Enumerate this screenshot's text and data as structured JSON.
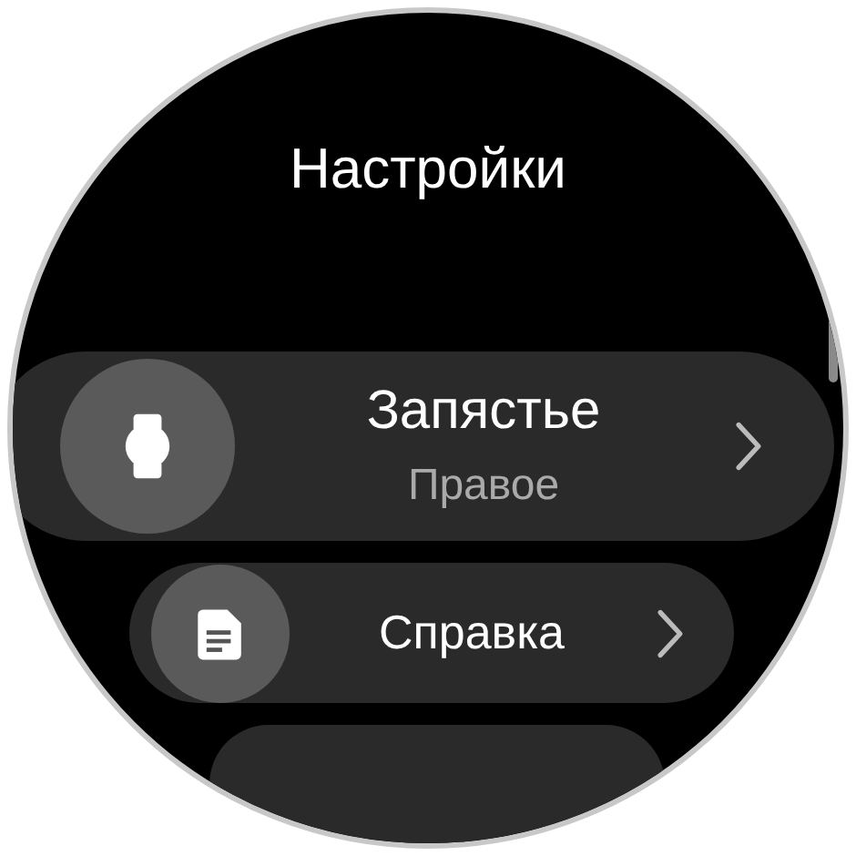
{
  "title": "Настройки",
  "items": [
    {
      "kind": "watch",
      "label": "Запястье",
      "value": "Правое"
    },
    {
      "kind": "document",
      "label": "Справка"
    }
  ]
}
